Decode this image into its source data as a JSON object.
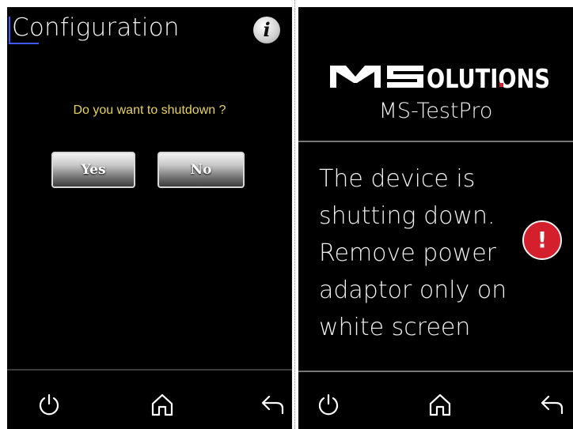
{
  "left_screen": {
    "title": "Configuration",
    "info_icon": "info-icon",
    "question": "Do you want to shutdown ?",
    "yes_label": "Yes",
    "no_label": "No"
  },
  "right_screen": {
    "logo_text": "MSOLUTIONS",
    "product": "MS-TestPro",
    "message_lines": [
      "The device is",
      "shutting down.",
      "Remove power",
      "adaptor only on",
      "white screen"
    ],
    "alert_icon": "exclamation-icon",
    "alert_color": "#d4202c"
  },
  "nav_icons": [
    "power-icon",
    "home-icon",
    "back-arrow-icon"
  ],
  "colors": {
    "question_text": "#e8d35a",
    "background": "#000000"
  }
}
